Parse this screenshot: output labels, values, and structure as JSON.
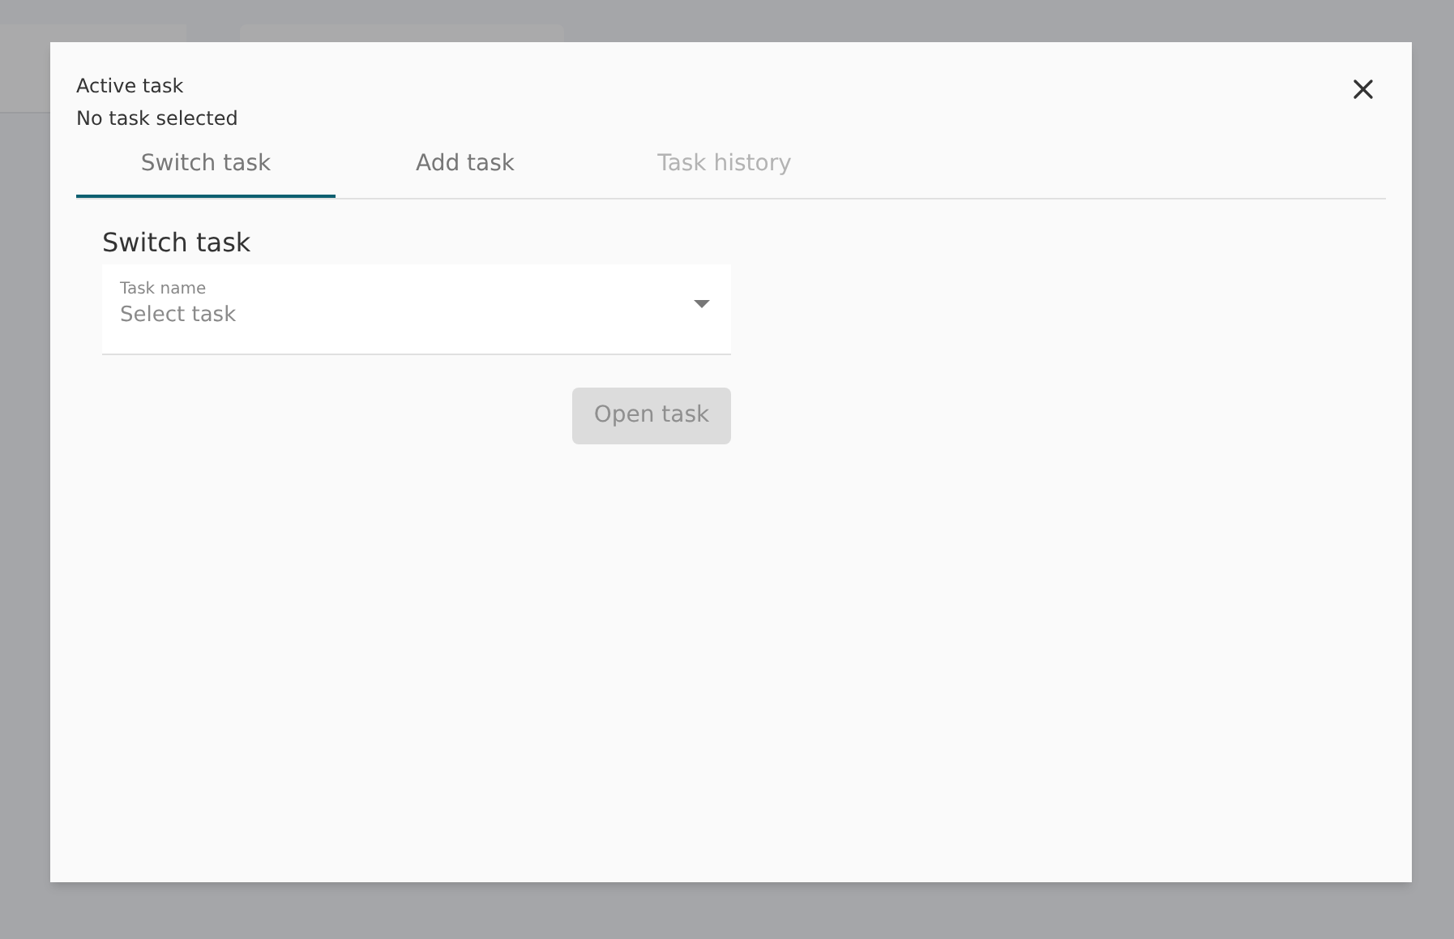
{
  "header": {
    "label": "Active task",
    "value": "No task selected"
  },
  "tabs": [
    {
      "label": "Switch task",
      "selected": true,
      "disabled": false
    },
    {
      "label": "Add task",
      "selected": false,
      "disabled": false
    },
    {
      "label": "Task history",
      "selected": false,
      "disabled": true
    }
  ],
  "panel": {
    "title": "Switch task",
    "field": {
      "label": "Task name",
      "placeholder": "Select task"
    },
    "button": {
      "label": "Open task",
      "disabled": true
    }
  }
}
